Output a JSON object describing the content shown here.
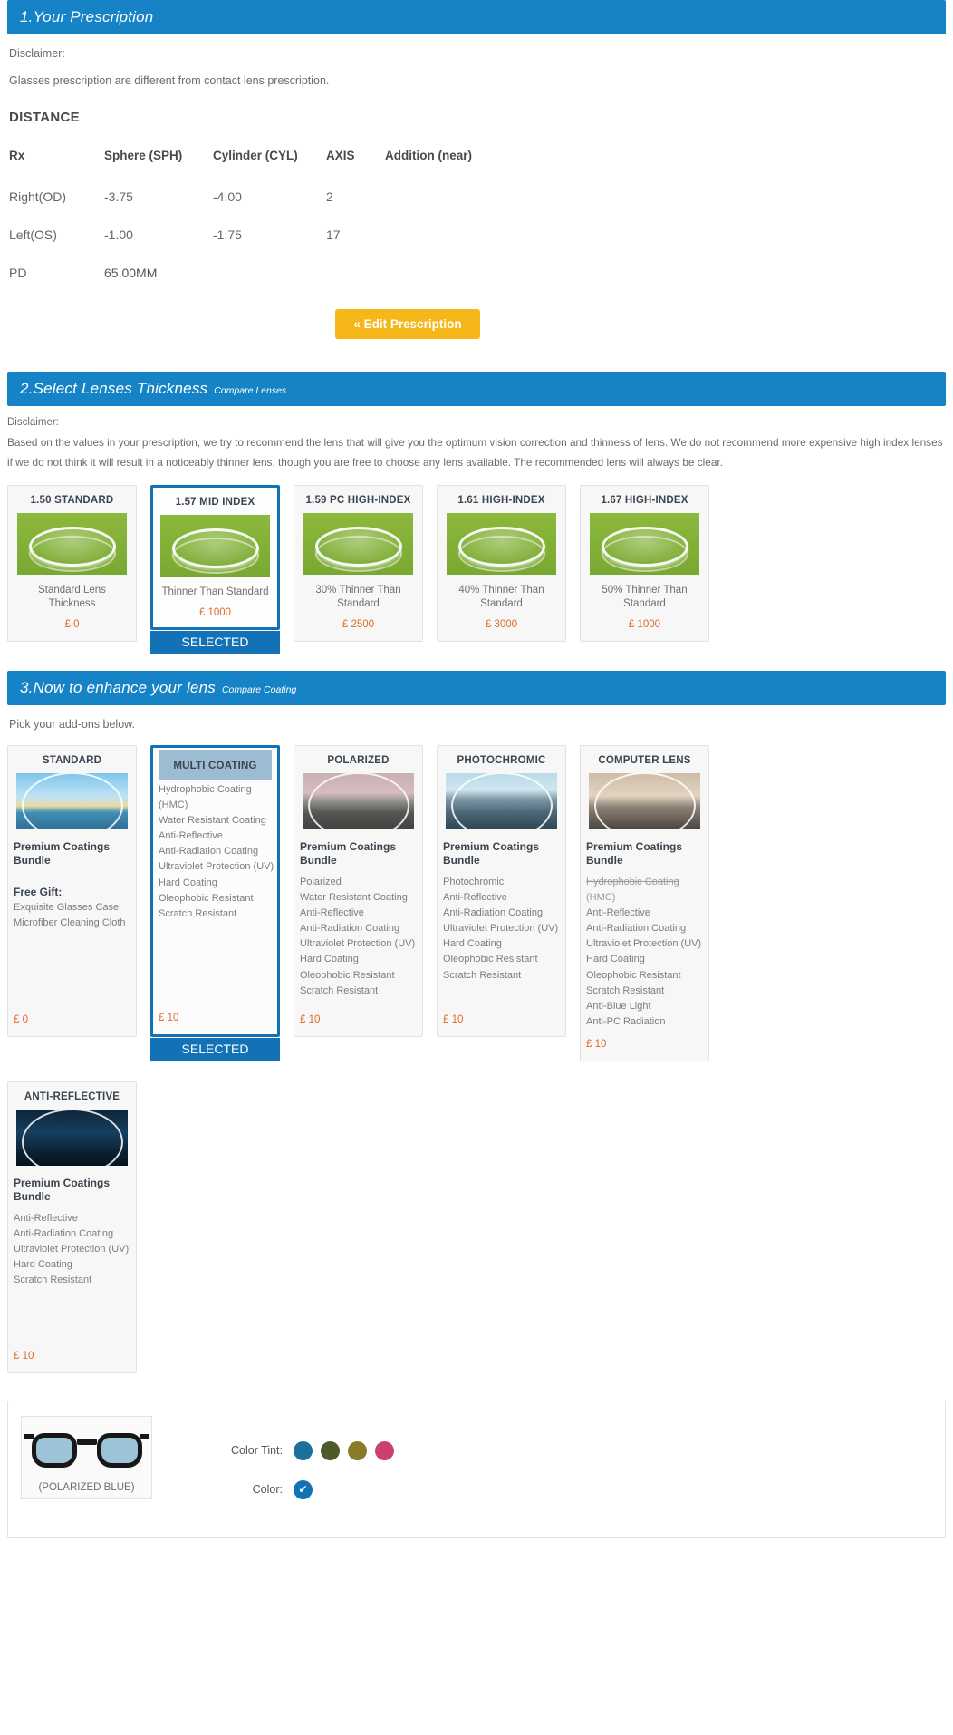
{
  "section1": {
    "title": "1.Your Prescription",
    "disclaimer_label": "Disclaimer:",
    "disclaimer_text": "Glasses prescription are different from contact lens prescription.",
    "distance_title": "DISTANCE",
    "table": {
      "headers": [
        "Rx",
        "Sphere (SPH)",
        "Cylinder (CYL)",
        "AXIS",
        "Addition (near)"
      ],
      "rows": [
        {
          "rx": "Right(OD)",
          "sph": "-3.75",
          "cyl": "-4.00",
          "axis": "2",
          "add": ""
        },
        {
          "rx": "Left(OS)",
          "sph": "-1.00",
          "cyl": "-1.75",
          "axis": "17",
          "add": ""
        }
      ],
      "pd_label": "PD",
      "pd_value": "65.00MM"
    },
    "edit_button": "« Edit Prescription"
  },
  "section2": {
    "title": "2.Select Lenses Thickness",
    "compare_link": "Compare Lenses",
    "disclaimer_label": "Disclaimer:",
    "disclaimer_text": "Based on the values in your prescription, we try to recommend the lens that will give you the optimum vision correction and thinness of lens. We do not recommend more expensive high index lenses if we do not think it will result in a noticeably thinner lens, though you are free to choose any lens available. The recommended lens will always be clear.",
    "selected_tag": "SELECTED",
    "lenses": [
      {
        "name": "1.50 STANDARD",
        "desc": "Standard Lens Thickness",
        "price": "£ 0",
        "selected": false
      },
      {
        "name": "1.57 MID INDEX",
        "desc": "Thinner Than Standard",
        "price": "£ 1000",
        "selected": true
      },
      {
        "name": "1.59 PC HIGH-INDEX",
        "desc": "30% Thinner Than Standard",
        "price": "£ 2500",
        "selected": false
      },
      {
        "name": "1.61 HIGH-INDEX",
        "desc": "40% Thinner Than Standard",
        "price": "£ 3000",
        "selected": false
      },
      {
        "name": "1.67 HIGH-INDEX",
        "desc": "50% Thinner Than Standard",
        "price": "£ 1000",
        "selected": false
      }
    ]
  },
  "section3": {
    "title": "3.Now to enhance your lens",
    "compare_link": "Compare Coating",
    "pick_text": "Pick your add-ons below.",
    "selected_tag": "SELECTED",
    "coatings": [
      {
        "name": "STANDARD",
        "image": "beach-scene",
        "bundle": "Premium Coatings Bundle",
        "free_gift_label": "Free Gift:",
        "features": [
          "Exquisite Glasses Case",
          "Microfiber Cleaning Cloth"
        ],
        "price": "£ 0",
        "selected": false
      },
      {
        "name": "MULTI COATING",
        "image": "blue-panel",
        "bundle": "",
        "features": [
          "Hydrophobic Coating (HMC)",
          "Water Resistant Coating",
          "Anti-Reflective",
          "Anti-Radiation Coating",
          "Ultraviolet Protection (UV)",
          "Hard Coating",
          "Oleophobic Resistant",
          "Scratch Resistant"
        ],
        "price": "£ 10",
        "selected": true
      },
      {
        "name": "POLARIZED",
        "image": "mountain-pink",
        "bundle": "Premium Coatings Bundle",
        "features": [
          "Polarized",
          "Water Resistant Coating",
          "Anti-Reflective",
          "Anti-Radiation Coating",
          "Ultraviolet Protection (UV)",
          "Hard Coating",
          "Oleophobic Resistant",
          "Scratch Resistant"
        ],
        "price": "£ 10",
        "selected": false
      },
      {
        "name": "PHOTOCHROMIC",
        "image": "mountain-blue",
        "bundle": "Premium Coatings Bundle",
        "features": [
          "Photochromic",
          "Anti-Reflective",
          "Anti-Radiation Coating",
          "Ultraviolet Protection (UV)",
          "Hard Coating",
          "Oleophobic Resistant",
          "Scratch Resistant"
        ],
        "price": "£ 10",
        "selected": false
      },
      {
        "name": "COMPUTER LENS",
        "image": "laptop-desk",
        "bundle": "Premium Coatings Bundle",
        "features": [
          "Hydrophobic Coating (HMC)",
          "Anti-Reflective",
          "Anti-Radiation Coating",
          "Ultraviolet Protection (UV)",
          "Hard Coating",
          "Oleophobic Resistant",
          "Scratch Resistant",
          "Anti-Blue Light",
          "Anti-PC Radiation"
        ],
        "struck_first": true,
        "price": "£ 10",
        "selected": false
      },
      {
        "name": "ANTI-REFLECTIVE",
        "image": "night-ship",
        "bundle": "Premium Coatings Bundle",
        "features": [
          "Anti-Reflective",
          "Anti-Radiation Coating",
          "Ultraviolet Protection (UV)",
          "Hard Coating",
          "Scratch Resistant"
        ],
        "price": "£ 10",
        "selected": false
      }
    ]
  },
  "tint_panel": {
    "preview_caption": "(POLARIZED BLUE)",
    "color_tint_label": "Color Tint:",
    "color_label": "Color:",
    "tint_swatches": [
      "#1d6f9e",
      "#4f5a2a",
      "#8a7b28",
      "#cc3f72"
    ],
    "color_swatches": [
      "#1272b5"
    ],
    "check_glyph": "✔"
  },
  "colors": {
    "header_blue": "#1683c6",
    "selected_blue": "#1272b5",
    "button_yellow": "#f5b719",
    "price_orange": "#dd6a28"
  }
}
